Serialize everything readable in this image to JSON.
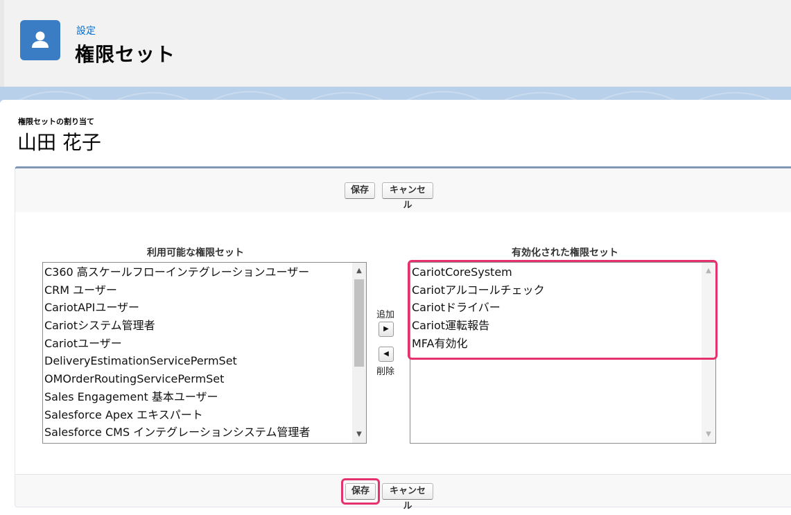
{
  "header": {
    "kicker": "設定",
    "title": "権限セット"
  },
  "assignment": {
    "label": "権限セットの割り当て",
    "user_name": "山田 花子"
  },
  "buttons": {
    "save": "保存",
    "cancel": "キャンセル"
  },
  "available": {
    "header": "利用可能な権限セット",
    "items": [
      "C360 高スケールフローインテグレーションユーザー",
      "CRM ユーザー",
      "CariotAPIユーザー",
      "Cariotシステム管理者",
      "Cariotユーザー",
      "DeliveryEstimationServicePermSet",
      "OMOrderRoutingServicePermSet",
      "Sales Engagement 基本ユーザー",
      "Salesforce Apex エキスパート",
      "Salesforce CMS インテグレーションシステム管理者"
    ]
  },
  "enabled": {
    "header": "有効化された権限セット",
    "items": [
      "CariotCoreSystem",
      "Cariotアルコールチェック",
      "Cariotドライバー",
      "Cariot運転報告",
      "MFA有効化"
    ]
  },
  "mover": {
    "add_label": "追加",
    "remove_label": "削除"
  },
  "icons": {
    "header": "user-icon",
    "add": "right-arrow-icon",
    "remove": "left-arrow-icon",
    "scroll_up": "scroll-up-icon",
    "scroll_down": "scroll-down-icon"
  },
  "colors": {
    "accent": "#0070d2",
    "icon_bg": "#3b7dc4",
    "highlight": "#e5326f"
  }
}
